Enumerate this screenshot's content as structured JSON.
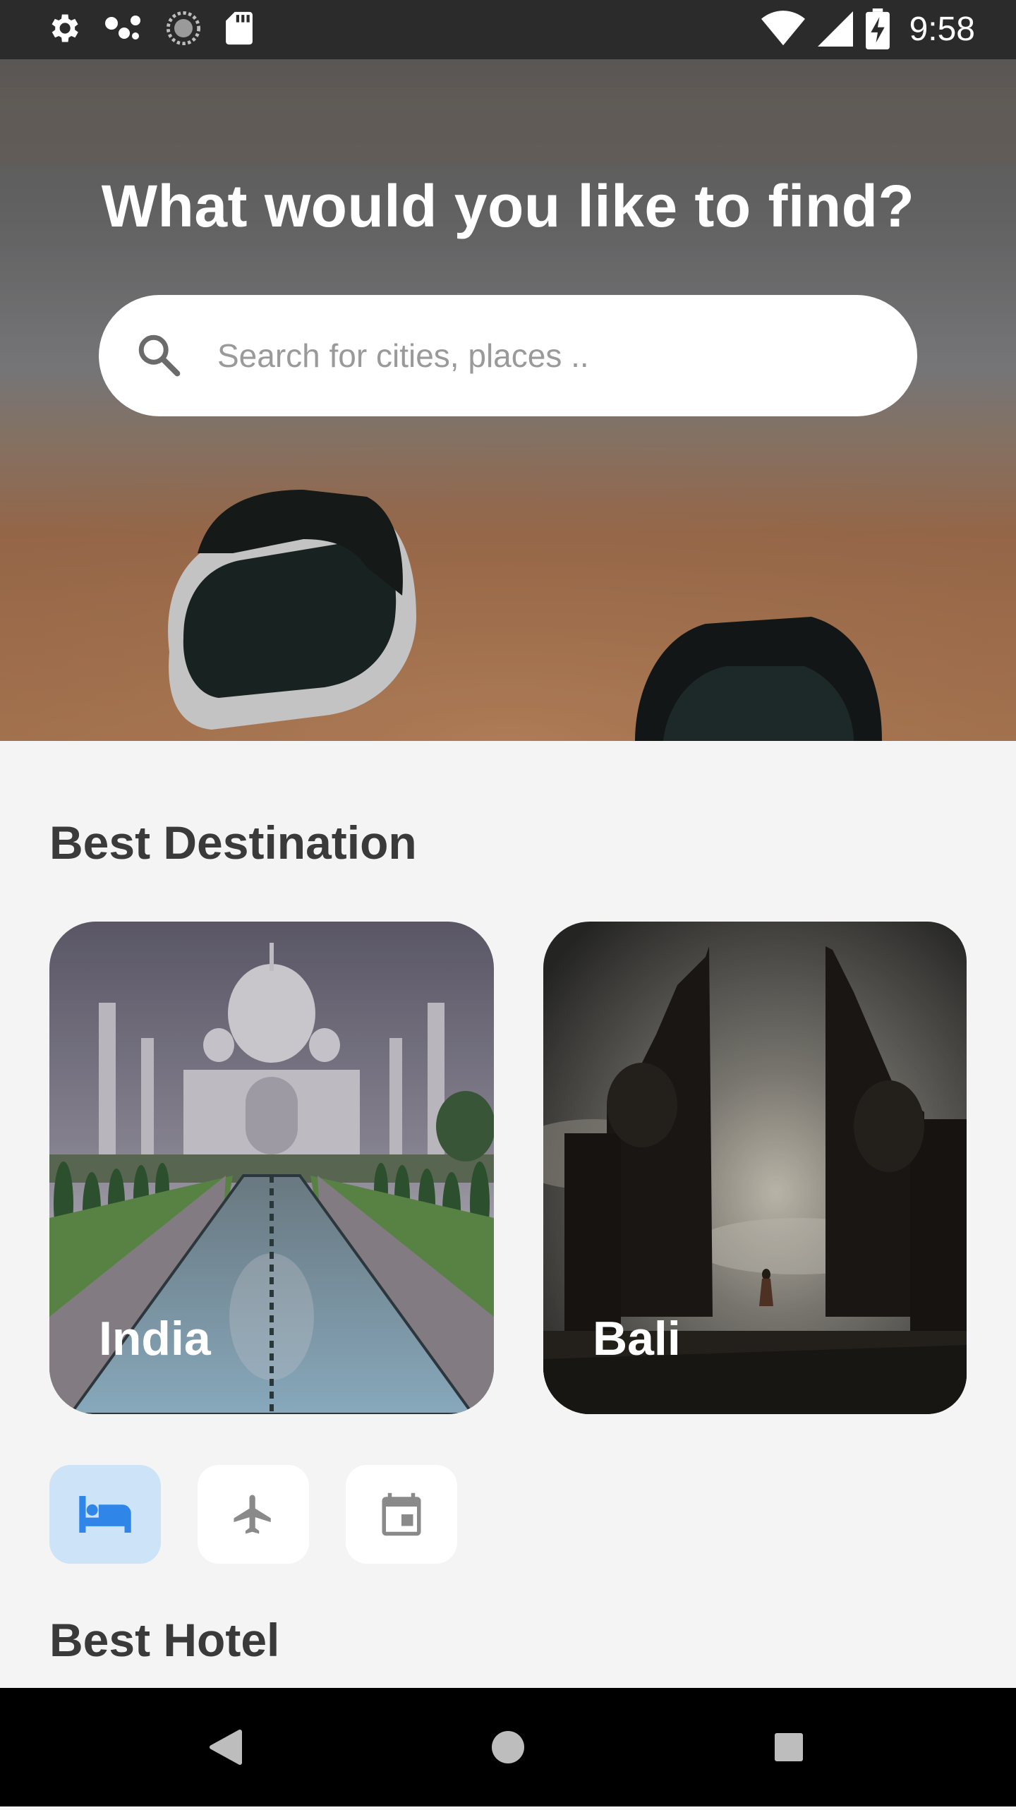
{
  "status_bar": {
    "time": "9:58",
    "left_icons": [
      "settings-icon",
      "dots-icon",
      "sync-icon",
      "sd-card-icon"
    ],
    "right_icons": [
      "wifi-icon",
      "signal-icon",
      "battery-charging-icon"
    ]
  },
  "hero": {
    "title": "What would you like to find?",
    "search": {
      "placeholder": "Search for cities, places ..",
      "value": ""
    }
  },
  "destinations": {
    "title": "Best Destination",
    "items": [
      {
        "label": "India"
      },
      {
        "label": "Bali"
      }
    ]
  },
  "categories": [
    {
      "icon": "bed-icon",
      "active": true
    },
    {
      "icon": "airplane-icon",
      "active": false
    },
    {
      "icon": "calendar-icon",
      "active": false
    }
  ],
  "hotels": {
    "title": "Best Hotel"
  },
  "nav_bar": {
    "buttons": [
      "back-icon",
      "home-icon",
      "recents-icon"
    ]
  },
  "colors": {
    "accent": "#2f86e8",
    "active_category_bg": "#cde3f7",
    "page_bg": "#f4f4f5",
    "heading": "#3a3a3a"
  }
}
